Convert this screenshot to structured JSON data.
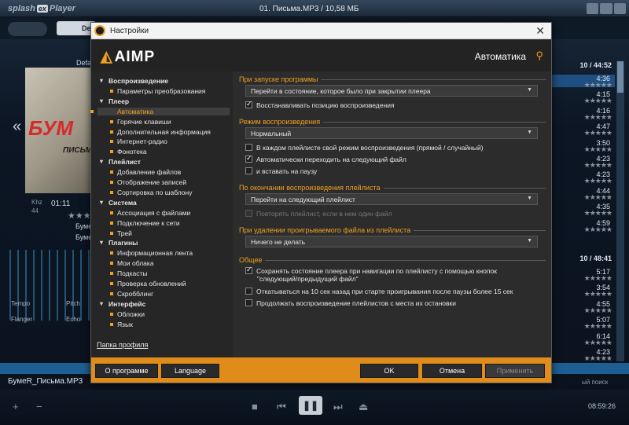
{
  "player": {
    "logo_text": "splash",
    "logo_ex": "ex",
    "logo_player": "Player",
    "window_title": "01. Письма.MP3 / 10,58 МБ",
    "preset_label": "De",
    "default_label": "Defa",
    "cover_big": "БУМ",
    "cover_small": "ПИСЬМА",
    "khz_label": "Khz",
    "khz_value": "44",
    "time": "01:11",
    "artist_line1": "Бумер",
    "artist_line2": "Буме",
    "eq_labels": [
      "Tempo",
      "Pitch",
      "Flanger",
      "Echo"
    ],
    "playlist_header1": "10 / 44:52",
    "playlist_header2": "10 / 48:41",
    "playlist_durations_1": [
      "4:36",
      "4:15",
      "4:16",
      "4:47",
      "3:50",
      "4:23",
      "4:23",
      "4:44",
      "4:35",
      "4:59"
    ],
    "playlist_durations_2": [
      "5:17",
      "3:54",
      "4:55",
      "5:07",
      "6:14",
      "4:23"
    ],
    "status_text": "БумеR_Письма.MP3",
    "status_right": "ый поиск",
    "clock": "08:59:26",
    "controls": {
      "add": "+",
      "remove": "−",
      "stop": "■",
      "prev": "⏮",
      "pause": "❚❚",
      "next": "⏭",
      "eject": "⏏"
    }
  },
  "dialog": {
    "title": "Настройки",
    "brand": "AIMP",
    "section_title": "Автоматика",
    "tree": [
      {
        "label": "Воспроизведение",
        "type": "cat"
      },
      {
        "label": "Параметры преобразования",
        "type": "sub"
      },
      {
        "label": "Плеер",
        "type": "cat"
      },
      {
        "label": "Автоматика",
        "type": "sub",
        "selected": true
      },
      {
        "label": "Горячие клавиши",
        "type": "sub"
      },
      {
        "label": "Дополнительная информация",
        "type": "sub"
      },
      {
        "label": "Интернет-радио",
        "type": "sub"
      },
      {
        "label": "Фонотека",
        "type": "sub"
      },
      {
        "label": "Плейлист",
        "type": "cat"
      },
      {
        "label": "Добавление файлов",
        "type": "sub"
      },
      {
        "label": "Отображение записей",
        "type": "sub"
      },
      {
        "label": "Сортировка по шаблону",
        "type": "sub"
      },
      {
        "label": "Система",
        "type": "cat"
      },
      {
        "label": "Ассоциация с файлами",
        "type": "sub"
      },
      {
        "label": "Подключение к сети",
        "type": "sub"
      },
      {
        "label": "Трей",
        "type": "sub"
      },
      {
        "label": "Плагины",
        "type": "cat"
      },
      {
        "label": "Информационная лента",
        "type": "sub"
      },
      {
        "label": "Мои облака",
        "type": "sub"
      },
      {
        "label": "Подкасты",
        "type": "sub"
      },
      {
        "label": "Проверка обновлений",
        "type": "sub"
      },
      {
        "label": "Скробблинг",
        "type": "sub"
      },
      {
        "label": "Интерфейс",
        "type": "cat"
      },
      {
        "label": "Обложки",
        "type": "sub"
      },
      {
        "label": "Язык",
        "type": "sub"
      }
    ],
    "profile_link": "Папка профиля",
    "groups": {
      "startup": {
        "title": "При запуске программы",
        "combo": "Перейти в состояние, которое было при закрытии плеера",
        "restore_position": "Восстанавливать позицию воспроизведения"
      },
      "playback_mode": {
        "title": "Режим воспроизведения",
        "combo": "Нормальный",
        "per_playlist": "В каждом плейлисте свой режим воспроизведения (прямой / случайный)",
        "auto_next": "Автоматически переходить на следующий файл",
        "and_pause": "и вставать на паузу"
      },
      "playlist_end": {
        "title": "По окончании воспроизведения плейлиста",
        "combo": "Перейти на следующий плейлист",
        "repeat_single": "Повторять плейлист, если в нем один файл"
      },
      "on_delete": {
        "title": "При удалении проигрываемого файла из плейлиста",
        "combo": "Ничего не делать"
      },
      "general": {
        "title": "Общее",
        "save_state_line1": "Сохранять состояние плеера при навигации по плейлисту с помощью кнопок",
        "save_state_line2": "\"следующий/предыдущий файл\"",
        "rewind_10": "Откатываться на 10 сек назад при старте проигрывания после паузы более 15 сек",
        "continue_playlists": "Продолжать воспроизведение плейлистов с места их остановки"
      }
    },
    "buttons": {
      "about": "О программе",
      "language": "Language",
      "ok": "OK",
      "cancel": "Отмена",
      "apply": "Применить"
    },
    "accent_color": "#f0a020",
    "footer_color": "#e08c1a"
  }
}
